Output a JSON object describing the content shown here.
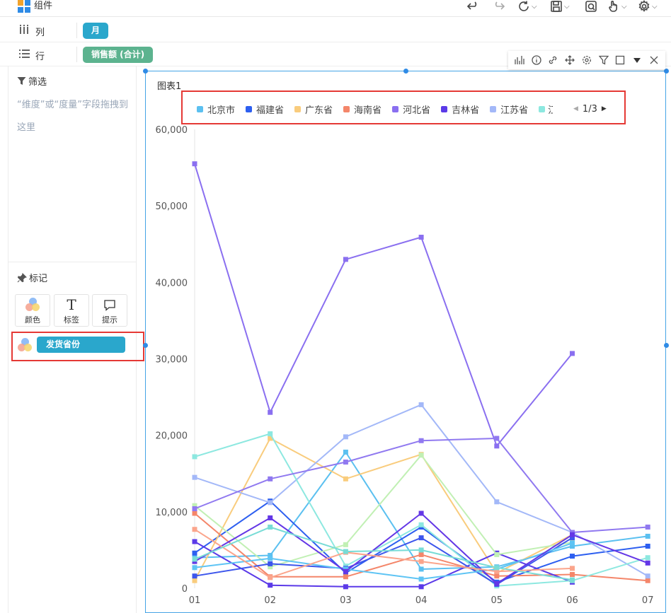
{
  "toolbar": {
    "title": "组件"
  },
  "shelves": {
    "columns": {
      "label": "列",
      "pill": "月",
      "pill_color": "#2aa7cc"
    },
    "rows": {
      "label": "行",
      "pill": "销售额 (合计)",
      "pill_color": "#5cb38f"
    }
  },
  "left_panel": {
    "filter_title": "筛选",
    "filter_hint": "“维度”或“度量”字段拖拽到这里",
    "marks_title": "标记",
    "mark_buttons": [
      {
        "label": "颜色",
        "icon": "color-icon"
      },
      {
        "label": "标签",
        "icon": "text-icon"
      },
      {
        "label": "提示",
        "icon": "tooltip-icon"
      }
    ],
    "color_field": "发货省份"
  },
  "chart_title": "图表1",
  "legend": {
    "page": "1/3",
    "truncated_item": "江西省"
  },
  "chart_data": {
    "type": "line",
    "categories": [
      "01",
      "02",
      "03",
      "04",
      "05",
      "06",
      "07"
    ],
    "ylim": [
      0,
      60000
    ],
    "y_ticks": [
      "0",
      "10,000",
      "20,000",
      "30,000",
      "40,000",
      "50,000",
      "60,000"
    ],
    "grid": false,
    "legend_position": "top",
    "series": [
      {
        "name": "北京市",
        "color": "#5bc0f0",
        "values": [
          4000,
          4300,
          17800,
          2500,
          2800,
          5500,
          6800
        ]
      },
      {
        "name": "福建省",
        "color": "#2d5ff0",
        "values": [
          4600,
          11400,
          2000,
          8000,
          800,
          4200,
          5500
        ]
      },
      {
        "name": "广东省",
        "color": "#f9cc7d",
        "values": [
          1000,
          19600,
          14300,
          17500,
          2000,
          7000,
          null
        ]
      },
      {
        "name": "海南省",
        "color": "#f4866a",
        "values": [
          9800,
          1500,
          1500,
          4400,
          1600,
          1800,
          1000
        ]
      },
      {
        "name": "河北省",
        "color": "#8a6ff0",
        "values": [
          55500,
          23000,
          43000,
          45900,
          18600,
          30700,
          null
        ]
      },
      {
        "name": "吉林省",
        "color": "#5b3ae8",
        "values": [
          6100,
          400,
          200,
          200,
          4600,
          800,
          null
        ]
      },
      {
        "name": "江苏省",
        "color": "#a3b8f8",
        "values": [
          14500,
          11200,
          19800,
          24000,
          11300,
          7300,
          1600
        ]
      },
      {
        "name": null,
        "color": "#8de8e0",
        "values": [
          17200,
          20200,
          2900,
          8300,
          300,
          1000,
          4000
        ]
      },
      {
        "name": null,
        "color": "#c1f0b4",
        "values": [
          10800,
          2800,
          5700,
          17400,
          4400,
          6000,
          null
        ]
      },
      {
        "name": null,
        "color": "#9079f0",
        "values": [
          10400,
          14300,
          16500,
          19300,
          19600,
          7300,
          8000
        ]
      },
      {
        "name": null,
        "color": "#3d56ec",
        "values": [
          1600,
          3200,
          2600,
          6600,
          500,
          6600,
          null
        ]
      },
      {
        "name": null,
        "color": "#5ec4f4",
        "values": [
          2700,
          3900,
          2500,
          1200,
          2500,
          5900,
          null
        ]
      },
      {
        "name": null,
        "color": "#6437e6",
        "values": [
          3500,
          9200,
          2200,
          9800,
          600,
          7000,
          3300
        ]
      },
      {
        "name": null,
        "color": "#fba58c",
        "values": [
          7700,
          1400,
          4700,
          3500,
          2200,
          2600,
          null
        ]
      },
      {
        "name": null,
        "color": "#78dcd6",
        "values": [
          3800,
          8000,
          4800,
          5000,
          2700,
          1100,
          null
        ]
      }
    ]
  }
}
